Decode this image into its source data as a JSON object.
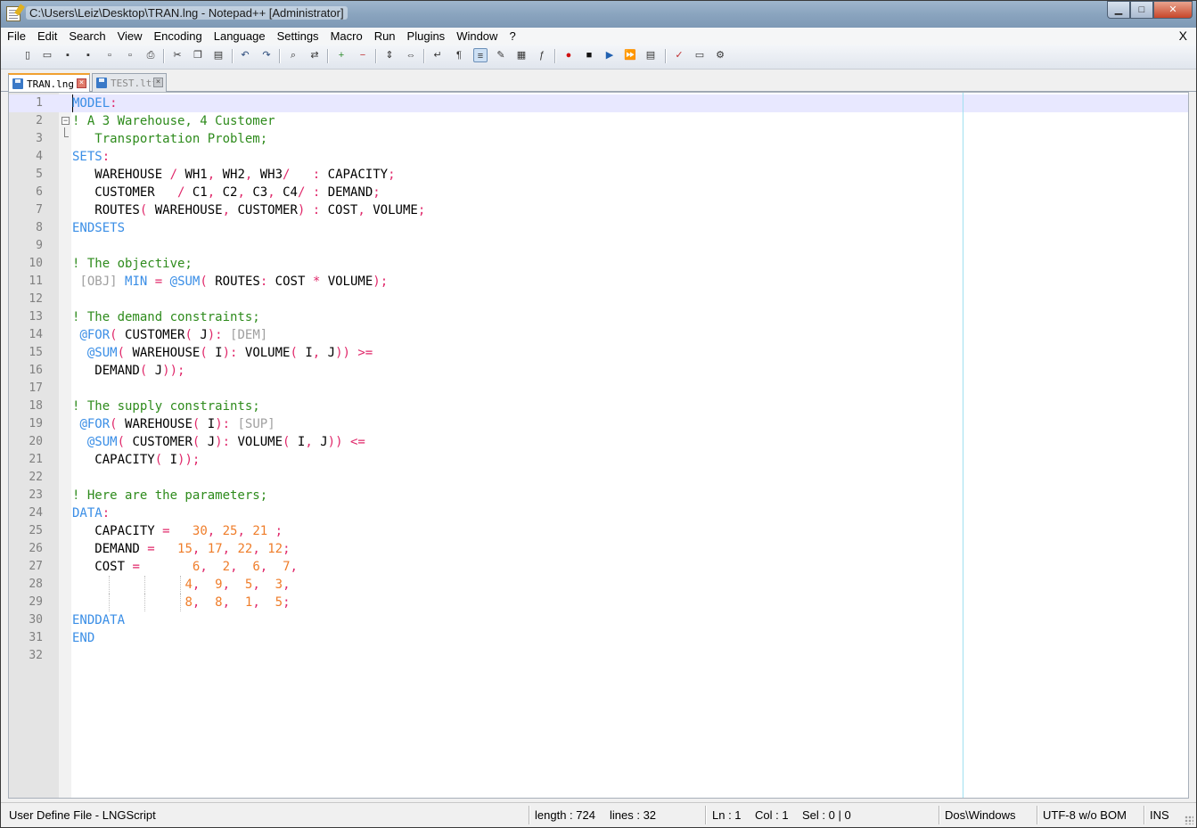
{
  "window": {
    "title": "C:\\Users\\Leiz\\Desktop\\TRAN.lng - Notepad++ [Administrator]",
    "controls": {
      "minimize": "▁",
      "maximize": "□",
      "close": "✕"
    }
  },
  "menubar": {
    "items": [
      "File",
      "Edit",
      "Search",
      "View",
      "Encoding",
      "Language",
      "Settings",
      "Macro",
      "Run",
      "Plugins",
      "Window",
      "?"
    ],
    "close": "X"
  },
  "toolbar": {
    "icons": [
      "new-file-icon",
      "open-file-icon",
      "save-icon",
      "save-all-icon",
      "close-icon",
      "close-all-icon",
      "print-icon",
      "cut-icon",
      "copy-icon",
      "paste-icon",
      "undo-icon",
      "redo-icon",
      "find-icon",
      "replace-icon",
      "zoom-in-icon",
      "zoom-out-icon",
      "sync-vertical-icon",
      "sync-horizontal-icon",
      "word-wrap-icon",
      "show-all-chars-icon",
      "indent-guide-icon",
      "user-lang-icon",
      "doc-map-icon",
      "function-list-icon",
      "record-macro-icon",
      "stop-macro-icon",
      "play-macro-icon",
      "run-macro-multiple-icon",
      "save-macro-icon",
      "spell-check-icon",
      "console-icon",
      "plugin-icon"
    ]
  },
  "tabs": [
    {
      "label": "TRAN.lng",
      "active": true
    },
    {
      "label": "TEST.ltf",
      "active": false
    }
  ],
  "editor": {
    "line_count": 32,
    "lines": [
      [
        [
          "kw",
          "MODEL"
        ],
        [
          "op",
          ":"
        ]
      ],
      [
        [
          "cm",
          "! A 3 Warehouse, 4 Customer"
        ]
      ],
      [
        [
          "cm",
          "   Transportation Problem;"
        ]
      ],
      [
        [
          "kw",
          "SETS"
        ],
        [
          "op",
          ":"
        ]
      ],
      [
        [
          "tx",
          "   WAREHOUSE "
        ],
        [
          "op",
          "/"
        ],
        [
          "tx",
          " WH1"
        ],
        [
          "op",
          ","
        ],
        [
          "tx",
          " WH2"
        ],
        [
          "op",
          ","
        ],
        [
          "tx",
          " WH3"
        ],
        [
          "op",
          "/"
        ],
        [
          "tx",
          "   "
        ],
        [
          "op",
          ":"
        ],
        [
          "tx",
          " CAPACITY"
        ],
        [
          "op",
          ";"
        ]
      ],
      [
        [
          "tx",
          "   CUSTOMER   "
        ],
        [
          "op",
          "/"
        ],
        [
          "tx",
          " C1"
        ],
        [
          "op",
          ","
        ],
        [
          "tx",
          " C2"
        ],
        [
          "op",
          ","
        ],
        [
          "tx",
          " C3"
        ],
        [
          "op",
          ","
        ],
        [
          "tx",
          " C4"
        ],
        [
          "op",
          "/"
        ],
        [
          "tx",
          " "
        ],
        [
          "op",
          ":"
        ],
        [
          "tx",
          " DEMAND"
        ],
        [
          "op",
          ";"
        ]
      ],
      [
        [
          "tx",
          "   ROUTES"
        ],
        [
          "op",
          "("
        ],
        [
          "tx",
          " WAREHOUSE"
        ],
        [
          "op",
          ","
        ],
        [
          "tx",
          " CUSTOMER"
        ],
        [
          "op",
          ")"
        ],
        [
          "tx",
          " "
        ],
        [
          "op",
          ":"
        ],
        [
          "tx",
          " COST"
        ],
        [
          "op",
          ","
        ],
        [
          "tx",
          " VOLUME"
        ],
        [
          "op",
          ";"
        ]
      ],
      [
        [
          "kw",
          "ENDSETS"
        ]
      ],
      [],
      [
        [
          "cm",
          "! The objective;"
        ]
      ],
      [
        [
          "tx",
          " "
        ],
        [
          "lb",
          "[OBJ]"
        ],
        [
          "tx",
          " "
        ],
        [
          "kw",
          "MIN"
        ],
        [
          "tx",
          " "
        ],
        [
          "op",
          "="
        ],
        [
          "tx",
          " "
        ],
        [
          "kw",
          "@SUM"
        ],
        [
          "op",
          "("
        ],
        [
          "tx",
          " ROUTES"
        ],
        [
          "op",
          ":"
        ],
        [
          "tx",
          " COST "
        ],
        [
          "op",
          "*"
        ],
        [
          "tx",
          " VOLUME"
        ],
        [
          "op",
          ");"
        ]
      ],
      [],
      [
        [
          "cm",
          "! The demand constraints;"
        ]
      ],
      [
        [
          "tx",
          " "
        ],
        [
          "kw",
          "@FOR"
        ],
        [
          "op",
          "("
        ],
        [
          "tx",
          " CUSTOMER"
        ],
        [
          "op",
          "("
        ],
        [
          "tx",
          " J"
        ],
        [
          "op",
          "):"
        ],
        [
          "tx",
          " "
        ],
        [
          "lb",
          "[DEM]"
        ]
      ],
      [
        [
          "tx",
          "  "
        ],
        [
          "kw",
          "@SUM"
        ],
        [
          "op",
          "("
        ],
        [
          "tx",
          " WAREHOUSE"
        ],
        [
          "op",
          "("
        ],
        [
          "tx",
          " I"
        ],
        [
          "op",
          "):"
        ],
        [
          "tx",
          " VOLUME"
        ],
        [
          "op",
          "("
        ],
        [
          "tx",
          " I"
        ],
        [
          "op",
          ","
        ],
        [
          "tx",
          " J"
        ],
        [
          "op",
          "))"
        ],
        [
          "tx",
          " "
        ],
        [
          "op",
          ">="
        ]
      ],
      [
        [
          "tx",
          "   DEMAND"
        ],
        [
          "op",
          "("
        ],
        [
          "tx",
          " J"
        ],
        [
          "op",
          "));"
        ]
      ],
      [],
      [
        [
          "cm",
          "! The supply constraints;"
        ]
      ],
      [
        [
          "tx",
          " "
        ],
        [
          "kw",
          "@FOR"
        ],
        [
          "op",
          "("
        ],
        [
          "tx",
          " WAREHOUSE"
        ],
        [
          "op",
          "("
        ],
        [
          "tx",
          " I"
        ],
        [
          "op",
          "):"
        ],
        [
          "tx",
          " "
        ],
        [
          "lb",
          "[SUP]"
        ]
      ],
      [
        [
          "tx",
          "  "
        ],
        [
          "kw",
          "@SUM"
        ],
        [
          "op",
          "("
        ],
        [
          "tx",
          " CUSTOMER"
        ],
        [
          "op",
          "("
        ],
        [
          "tx",
          " J"
        ],
        [
          "op",
          "):"
        ],
        [
          "tx",
          " VOLUME"
        ],
        [
          "op",
          "("
        ],
        [
          "tx",
          " I"
        ],
        [
          "op",
          ","
        ],
        [
          "tx",
          " J"
        ],
        [
          "op",
          "))"
        ],
        [
          "tx",
          " "
        ],
        [
          "op",
          "<="
        ]
      ],
      [
        [
          "tx",
          "   CAPACITY"
        ],
        [
          "op",
          "("
        ],
        [
          "tx",
          " I"
        ],
        [
          "op",
          "));"
        ]
      ],
      [],
      [
        [
          "cm",
          "! Here are the parameters;"
        ]
      ],
      [
        [
          "kw",
          "DATA"
        ],
        [
          "op",
          ":"
        ]
      ],
      [
        [
          "tx",
          "   CAPACITY "
        ],
        [
          "op",
          "="
        ],
        [
          "tx",
          "   "
        ],
        [
          "nm",
          "30"
        ],
        [
          "op",
          ","
        ],
        [
          "tx",
          " "
        ],
        [
          "nm",
          "25"
        ],
        [
          "op",
          ","
        ],
        [
          "tx",
          " "
        ],
        [
          "nm",
          "21"
        ],
        [
          "tx",
          " "
        ],
        [
          "op",
          ";"
        ]
      ],
      [
        [
          "tx",
          "   DEMAND "
        ],
        [
          "op",
          "="
        ],
        [
          "tx",
          "   "
        ],
        [
          "nm",
          "15"
        ],
        [
          "op",
          ","
        ],
        [
          "tx",
          " "
        ],
        [
          "nm",
          "17"
        ],
        [
          "op",
          ","
        ],
        [
          "tx",
          " "
        ],
        [
          "nm",
          "22"
        ],
        [
          "op",
          ","
        ],
        [
          "tx",
          " "
        ],
        [
          "nm",
          "12"
        ],
        [
          "op",
          ";"
        ]
      ],
      [
        [
          "tx",
          "   COST "
        ],
        [
          "op",
          "="
        ],
        [
          "tx",
          "       "
        ],
        [
          "nm",
          "6"
        ],
        [
          "op",
          ","
        ],
        [
          "tx",
          "  "
        ],
        [
          "nm",
          "2"
        ],
        [
          "op",
          ","
        ],
        [
          "tx",
          "  "
        ],
        [
          "nm",
          "6"
        ],
        [
          "op",
          ","
        ],
        [
          "tx",
          "  "
        ],
        [
          "nm",
          "7"
        ],
        [
          "op",
          ","
        ]
      ],
      [
        [
          "tx",
          "               "
        ],
        [
          "nm",
          "4"
        ],
        [
          "op",
          ","
        ],
        [
          "tx",
          "  "
        ],
        [
          "nm",
          "9"
        ],
        [
          "op",
          ","
        ],
        [
          "tx",
          "  "
        ],
        [
          "nm",
          "5"
        ],
        [
          "op",
          ","
        ],
        [
          "tx",
          "  "
        ],
        [
          "nm",
          "3"
        ],
        [
          "op",
          ","
        ]
      ],
      [
        [
          "tx",
          "               "
        ],
        [
          "nm",
          "8"
        ],
        [
          "op",
          ","
        ],
        [
          "tx",
          "  "
        ],
        [
          "nm",
          "8"
        ],
        [
          "op",
          ","
        ],
        [
          "tx",
          "  "
        ],
        [
          "nm",
          "1"
        ],
        [
          "op",
          ","
        ],
        [
          "tx",
          "  "
        ],
        [
          "nm",
          "5"
        ],
        [
          "op",
          ";"
        ]
      ],
      [
        [
          "kw",
          "ENDDATA"
        ]
      ],
      [
        [
          "kw",
          "END"
        ]
      ],
      []
    ]
  },
  "colors": {
    "keyword": "#3a8ee6",
    "comment": "#2e8b1c",
    "operator": "#e0286a",
    "number": "#ef7d2a",
    "label": "#a0a0a0",
    "current_line": "#e8e8ff",
    "tab_accent": "#f0a030"
  },
  "statusbar": {
    "file_type": "User Define File - LNGScript",
    "length": "length : 724",
    "lines": "lines : 32",
    "ln": "Ln : 1",
    "col": "Col : 1",
    "sel": "Sel : 0 | 0",
    "eol": "Dos\\Windows",
    "encoding": "UTF-8 w/o BOM",
    "mode": "INS"
  }
}
